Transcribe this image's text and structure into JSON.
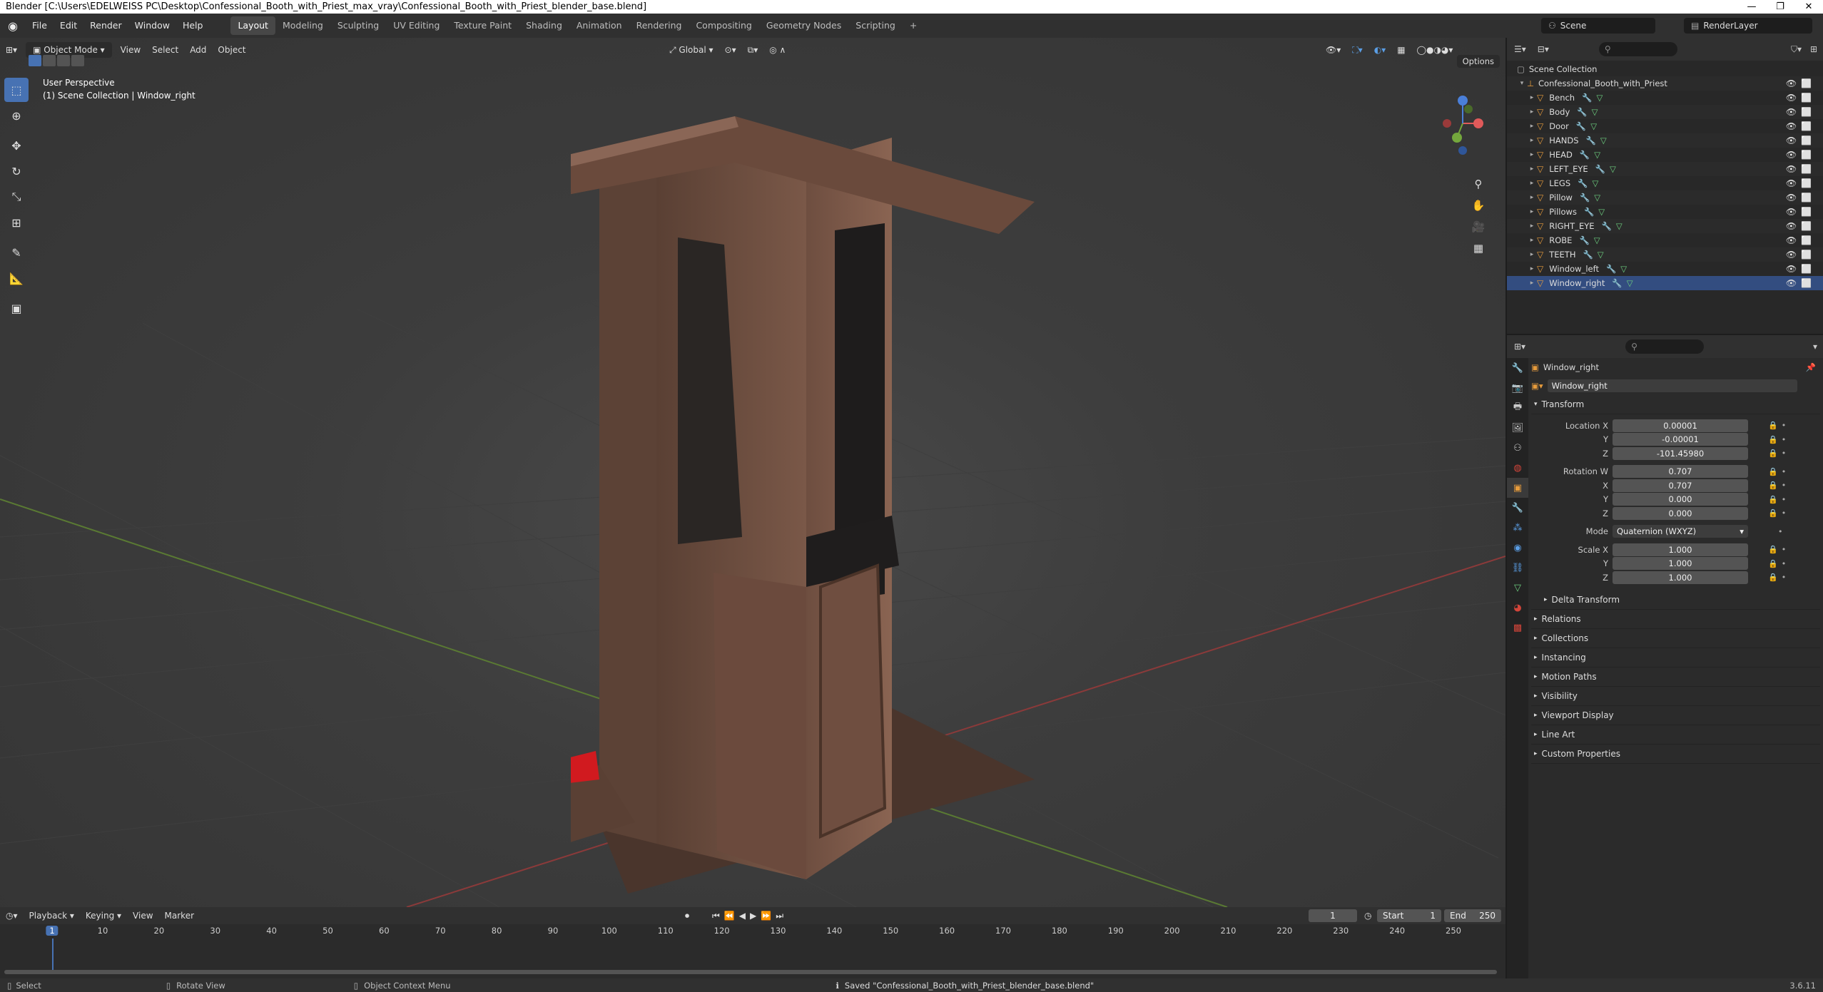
{
  "window": {
    "title": "Blender [C:\\Users\\EDELWEISS PC\\Desktop\\Confessional_Booth_with_Priest_max_vray\\Confessional_Booth_with_Priest_blender_base.blend]",
    "controls": [
      "—",
      "❐",
      "✕"
    ]
  },
  "menu": [
    "File",
    "Edit",
    "Render",
    "Window",
    "Help"
  ],
  "workspaces": [
    "Layout",
    "Modeling",
    "Sculpting",
    "UV Editing",
    "Texture Paint",
    "Shading",
    "Animation",
    "Rendering",
    "Compositing",
    "Geometry Nodes",
    "Scripting",
    "+"
  ],
  "scene": {
    "label": "Scene",
    "render_layer": "RenderLayer"
  },
  "viewport": {
    "mode": "Object Mode",
    "menus": [
      "View",
      "Select",
      "Add",
      "Object"
    ],
    "orientation": "Global",
    "options": "Options",
    "overlay_line1": "User Perspective",
    "overlay_line2": "(1) Scene Collection | Window_right",
    "axis_colors": {
      "x": "#e05a5a",
      "y": "#74a73d",
      "z": "#4a7fd8"
    }
  },
  "outliner": {
    "root": "Scene Collection",
    "collection": "Confessional_Booth_with_Priest",
    "items": [
      "Bench",
      "Body",
      "Door",
      "HANDS",
      "HEAD",
      "LEFT_EYE",
      "LEGS",
      "Pillow",
      "Pillows",
      "RIGHT_EYE",
      "ROBE",
      "TEETH",
      "Window_left",
      "Window_right"
    ],
    "selected": "Window_right"
  },
  "properties": {
    "object_name": "Window_right",
    "data_name": "Window_right",
    "transform_label": "Transform",
    "location_label": "Location X",
    "loc_x": "0.00001",
    "loc_y": "-0.00001",
    "loc_z": "-101.45980",
    "rotation_label": "Rotation W",
    "rot_w": "0.707",
    "rot_x": "0.707",
    "rot_y": "0.000",
    "rot_z": "0.000",
    "mode_label": "Mode",
    "mode_value": "Quaternion (WXYZ)",
    "scale_label": "Scale X",
    "scale_x": "1.000",
    "scale_y": "1.000",
    "scale_z": "1.000",
    "y": "Y",
    "z": "Z",
    "x": "X",
    "sections": [
      "Delta Transform",
      "Relations",
      "Collections",
      "Instancing",
      "Motion Paths",
      "Visibility",
      "Viewport Display",
      "Line Art",
      "Custom Properties"
    ]
  },
  "timeline": {
    "menus": [
      "Playback",
      "Keying",
      "View",
      "Marker"
    ],
    "current": "1",
    "start_label": "Start",
    "start": "1",
    "end_label": "End",
    "end": "250",
    "ticks": [
      "1",
      "10",
      "20",
      "30",
      "40",
      "50",
      "60",
      "70",
      "80",
      "90",
      "100",
      "110",
      "120",
      "130",
      "140",
      "150",
      "160",
      "170",
      "180",
      "190",
      "200",
      "210",
      "220",
      "230",
      "240",
      "250"
    ]
  },
  "status": {
    "select": "Select",
    "rotate": "Rotate View",
    "context": "Object Context Menu",
    "message": "Saved \"Confessional_Booth_with_Priest_blender_base.blend\"",
    "version": "3.6.11"
  }
}
